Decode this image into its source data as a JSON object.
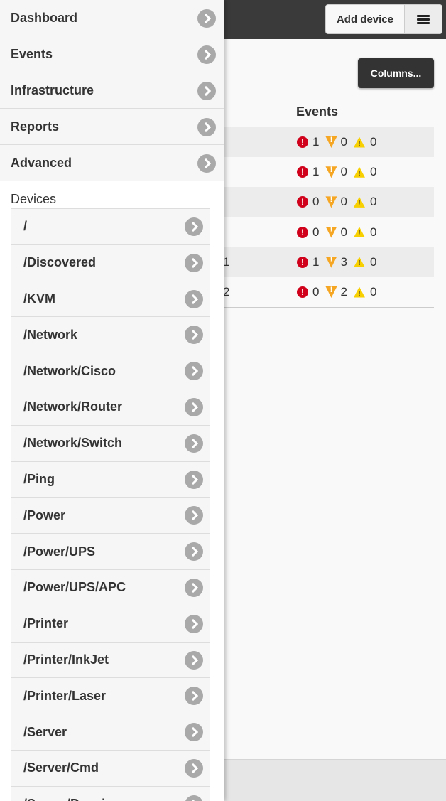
{
  "header": {
    "add_device_label": "Add device",
    "menu_icon": "hamburger-icon"
  },
  "toolbar": {
    "columns_label": "Columns..."
  },
  "table": {
    "events_header": "Events",
    "rows": [
      {
        "num": "",
        "critical": "1",
        "error": "0",
        "warning": "0"
      },
      {
        "num": "",
        "critical": "1",
        "error": "0",
        "warning": "0"
      },
      {
        "num": "",
        "critical": "0",
        "error": "0",
        "warning": "0"
      },
      {
        "num": "",
        "critical": "0",
        "error": "0",
        "warning": "0"
      },
      {
        "num": "1",
        "critical": "1",
        "error": "3",
        "warning": "0"
      },
      {
        "num": "2",
        "critical": "0",
        "error": "2",
        "warning": "0"
      }
    ]
  },
  "nav": {
    "items": [
      {
        "label": "Dashboard"
      },
      {
        "label": "Events"
      },
      {
        "label": "Infrastructure"
      },
      {
        "label": "Reports"
      },
      {
        "label": "Advanced"
      }
    ],
    "section_title": "Devices",
    "devices": [
      "/",
      "/Discovered",
      "/KVM",
      "/Network",
      "/Network/Cisco",
      "/Network/Router",
      "/Network/Switch",
      "/Ping",
      "/Power",
      "/Power/UPS",
      "/Power/UPS/APC",
      "/Printer",
      "/Printer/InkJet",
      "/Printer/Laser",
      "/Server",
      "/Server/Cmd",
      "/Server/Darwin"
    ]
  },
  "colors": {
    "critical": "#d0021b",
    "error": "#f5a623",
    "warning": "#f8d000",
    "topbar": "#3a3a3a"
  }
}
